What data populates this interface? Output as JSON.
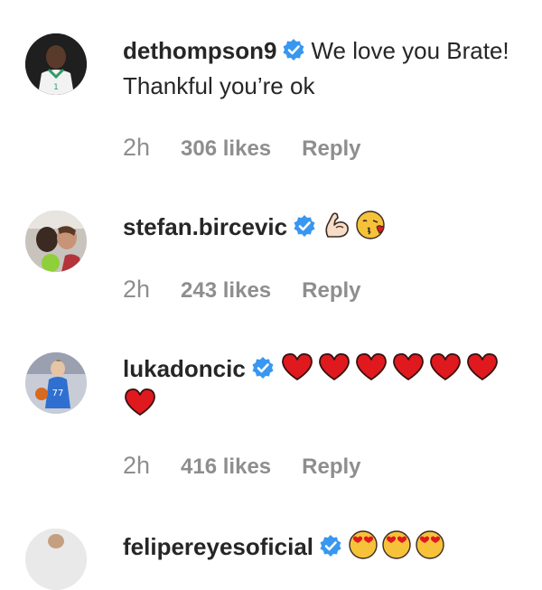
{
  "comments": [
    {
      "username": "dethompson9",
      "text": "We love you Brate! Thankful you’re ok",
      "time": "2h",
      "likes": "306 likes",
      "reply_label": "Reply",
      "avatar_icon": "player-jersey-avatar"
    },
    {
      "username": "stefan.bircevic",
      "text": "",
      "emojis": [
        "flexed-biceps",
        "face-blowing-kiss"
      ],
      "time": "2h",
      "likes": "243 likes",
      "reply_label": "Reply",
      "avatar_icon": "couple-photo-avatar"
    },
    {
      "username": "lukadoncic",
      "text": "",
      "emojis": [
        "red-heart",
        "red-heart",
        "red-heart",
        "red-heart",
        "red-heart",
        "red-heart",
        "red-heart"
      ],
      "time": "2h",
      "likes": "416 likes",
      "reply_label": "Reply",
      "avatar_icon": "basketball-player-avatar"
    },
    {
      "username": "felipereyesoficial",
      "emojis": [
        "heart-eyes-face",
        "heart-eyes-face",
        "heart-eyes-face"
      ],
      "avatar_icon": "player-avatar"
    }
  ],
  "colors": {
    "verified_blue": "#3897f0",
    "meta_gray": "#8e8e8e",
    "text": "#262626",
    "heart_red": "#e0191f"
  }
}
